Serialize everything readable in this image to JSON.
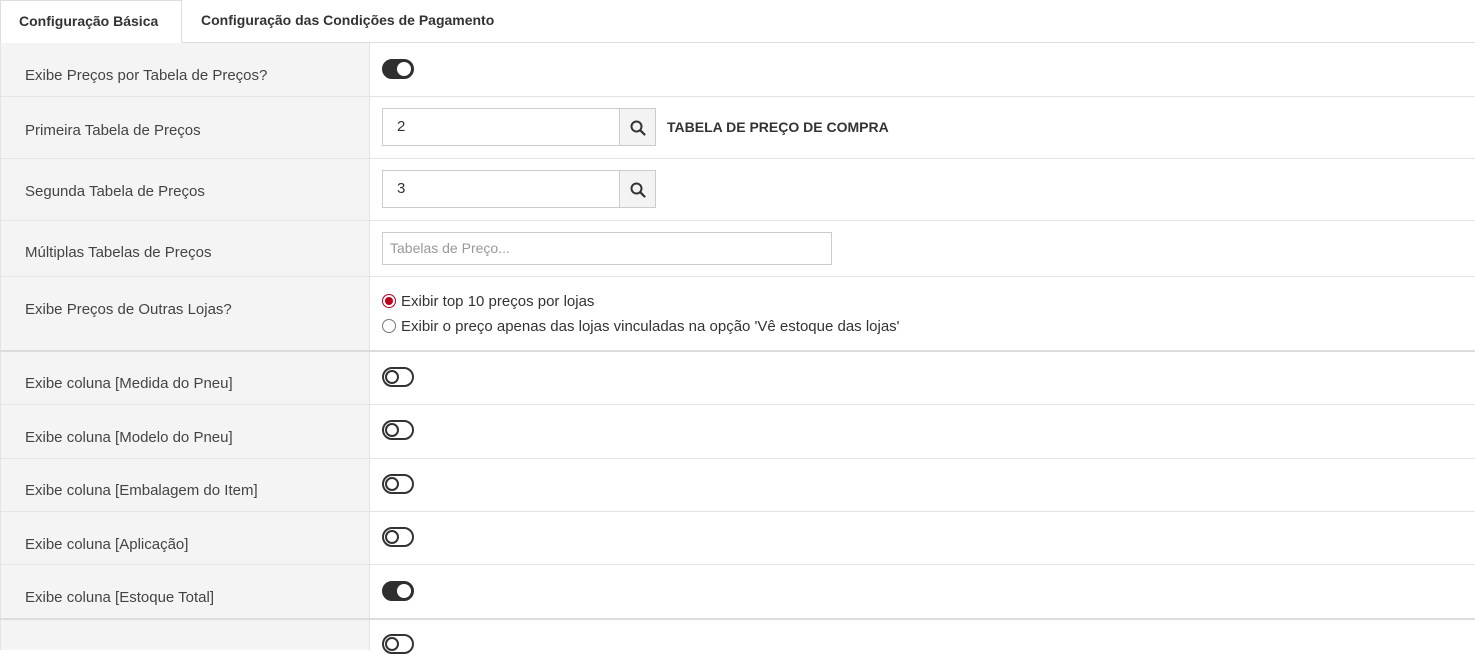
{
  "tabs": [
    {
      "label": "Configuração Básica",
      "active": true
    },
    {
      "label": "Configuração das Condições de Pagamento",
      "active": false
    }
  ],
  "rows": {
    "exibe_precos_tabela": {
      "label": "Exibe Preços por Tabela de Preços?",
      "toggle": "on"
    },
    "primeira_tabela": {
      "label": "Primeira Tabela de Preços",
      "value": "2",
      "description": "TABELA DE PREÇO DE COMPRA"
    },
    "segunda_tabela": {
      "label": "Segunda Tabela de Preços",
      "value": "3"
    },
    "multiplas_tabelas": {
      "label": "Múltiplas Tabelas de Preços",
      "placeholder": "Tabelas de Preço..."
    },
    "outras_lojas": {
      "label": "Exibe Preços de Outras Lojas?",
      "options": [
        {
          "label": "Exibir top 10 preços por lojas",
          "checked": true
        },
        {
          "label": "Exibir o preço apenas das lojas vinculadas na opção 'Vê estoque das lojas'",
          "checked": false
        }
      ]
    },
    "coluna_medida": {
      "label": "Exibe coluna [Medida do Pneu]",
      "toggle": "off"
    },
    "coluna_modelo": {
      "label": "Exibe coluna [Modelo do Pneu]",
      "toggle": "off"
    },
    "coluna_embalagem": {
      "label": "Exibe coluna [Embalagem do Item]",
      "toggle": "off"
    },
    "coluna_aplicacao": {
      "label": "Exibe coluna [Aplicação]",
      "toggle": "off"
    },
    "coluna_estoque": {
      "label": "Exibe coluna [Estoque Total]",
      "toggle": "on"
    }
  },
  "colors": {
    "toggle_on": "#2f2f2f",
    "radio_accent": "#c00018",
    "label_bg": "#f4f4f4"
  },
  "icons": {
    "search": "search-icon"
  }
}
